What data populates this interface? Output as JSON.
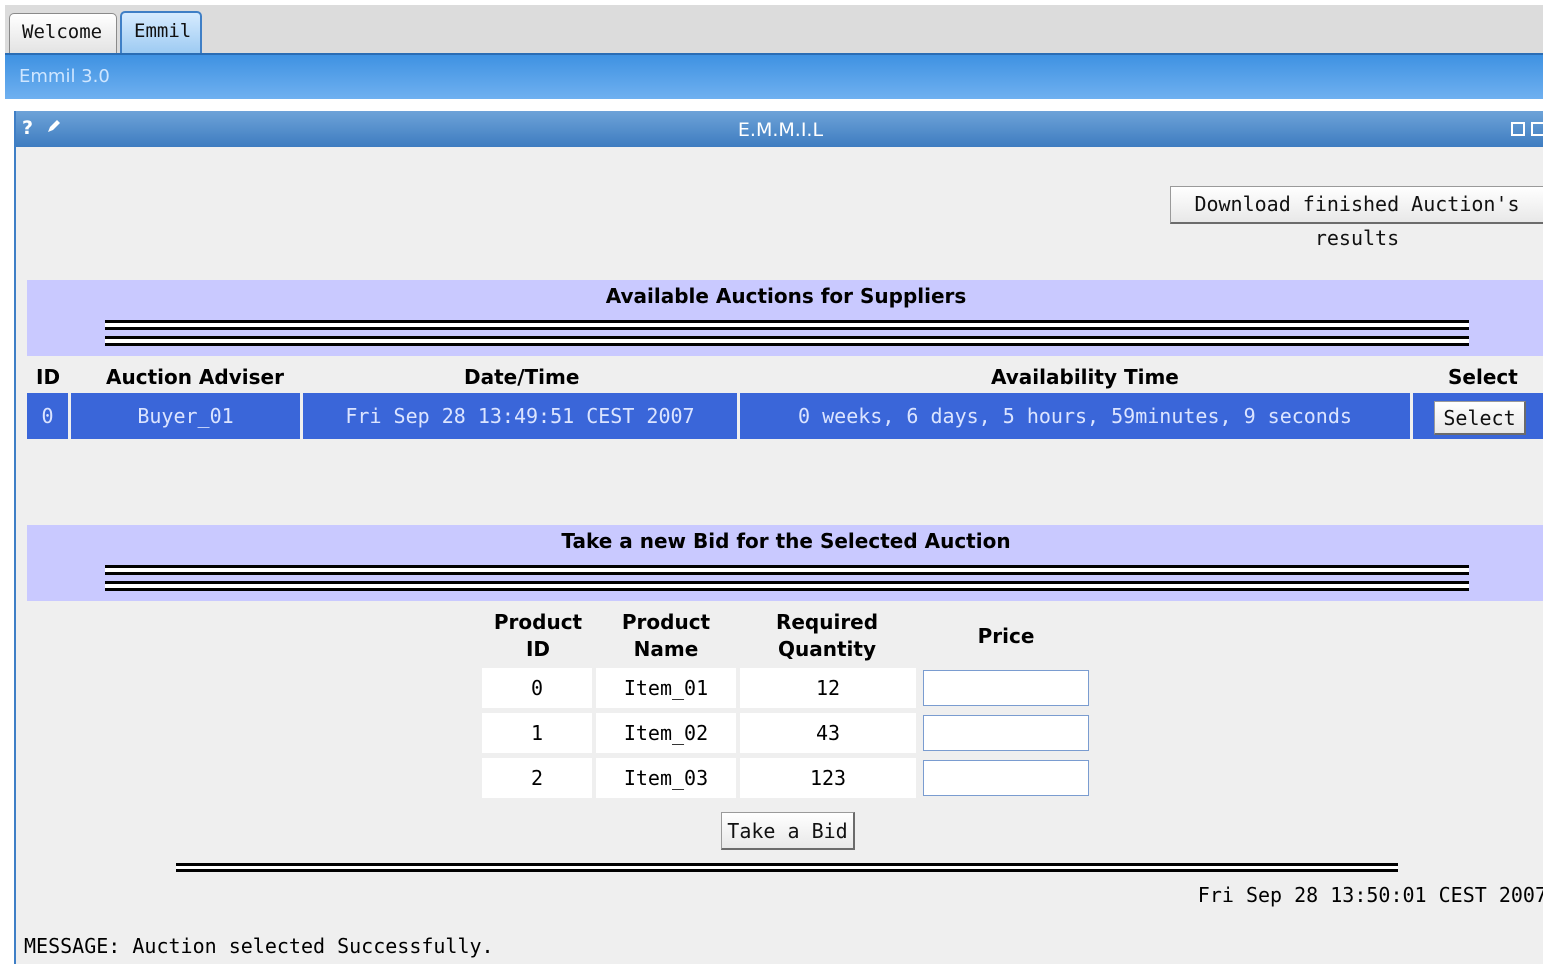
{
  "tabs": [
    {
      "label": "Welcome"
    },
    {
      "label": "Emmil"
    }
  ],
  "app": {
    "title": "Emmil 3.0"
  },
  "portlet": {
    "title": "E.M.M.I.L",
    "help_label": "?",
    "edit_icon": "pencil-icon",
    "minimize_icon": "minimize-icon",
    "maximize_icon": "maximize-icon"
  },
  "download_button": "Download finished Auction's results",
  "auctions": {
    "title": "Available Auctions for Suppliers",
    "headers": {
      "id": "ID",
      "adviser": "Auction Adviser",
      "datetime": "Date/Time",
      "availability": "Availability Time",
      "select": "Select"
    },
    "rows": [
      {
        "id": "0",
        "adviser": "Buyer_01",
        "datetime": "Fri Sep 28 13:49:51 CEST 2007",
        "availability": "0 weeks, 6 days, 5 hours, 59minutes, 9 seconds",
        "select_label": "Select"
      }
    ]
  },
  "bid": {
    "title": "Take a new Bid for the Selected Auction",
    "headers": {
      "product_id": "Product\nID",
      "product_name": "Product\nName",
      "required_quantity": "Required\nQuantity",
      "price": "Price"
    },
    "rows": [
      {
        "product_id": "0",
        "product_name": "Item_01",
        "quantity": "12",
        "price": ""
      },
      {
        "product_id": "1",
        "product_name": "Item_02",
        "quantity": "43",
        "price": ""
      },
      {
        "product_id": "2",
        "product_name": "Item_03",
        "quantity": "123",
        "price": ""
      }
    ],
    "submit_label": "Take a Bid"
  },
  "timestamp": "Fri Sep 28 13:50:01 CEST 2007",
  "message": "MESSAGE: Auction selected Successfully.",
  "colors": {
    "selected_row": "#3a66d9",
    "band": "#c9c9ff",
    "header_blue": "#3e7cc0"
  }
}
